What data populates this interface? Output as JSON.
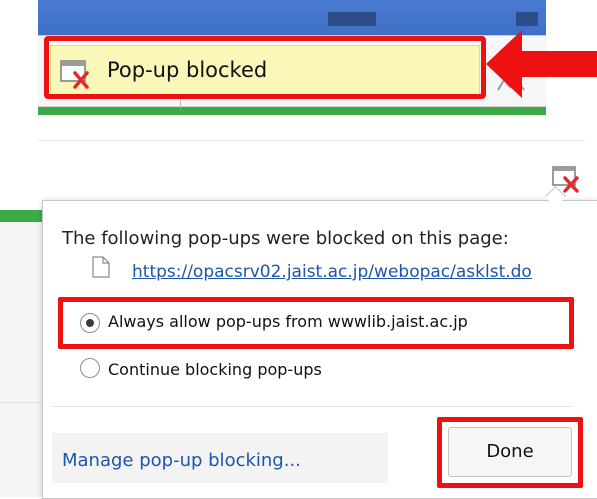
{
  "infobar": {
    "message": "Pop-up blocked",
    "icon": "popup-blocked-icon"
  },
  "bubble": {
    "title": "The following pop-ups were blocked on this page:",
    "blocked_url": "https://opacsrv02.jaist.ac.jp/webopac/asklst.do",
    "options": {
      "allow_label": "Always allow pop-ups from wwwlib.jaist.ac.jp",
      "continue_label": "Continue blocking pop-ups",
      "selected": "allow"
    },
    "manage_label": "Manage pop-up blocking...",
    "done_label": "Done"
  },
  "colors": {
    "highlight": "#ee1111",
    "infobar_bg": "#faf8b8",
    "link": "#1c55ac",
    "accent_green": "#3cab47",
    "chrome_blue": "#4a7bd0"
  }
}
